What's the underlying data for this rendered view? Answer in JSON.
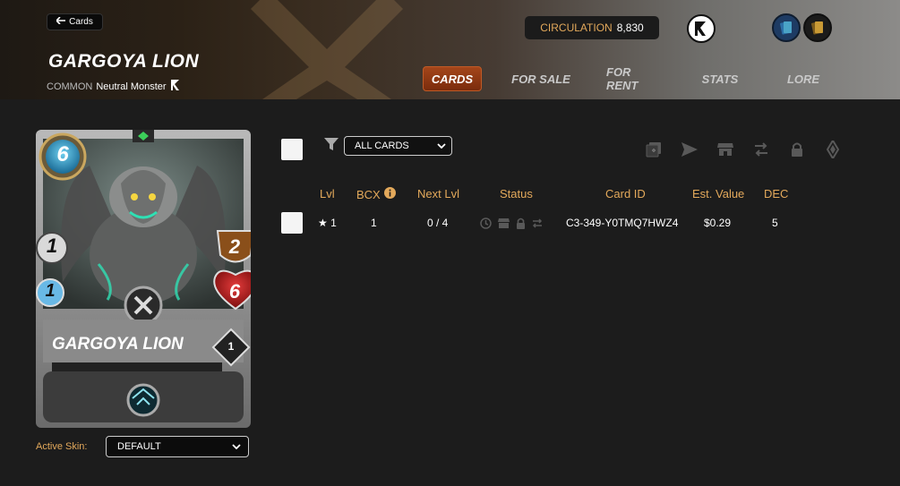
{
  "header": {
    "back_label": "Cards",
    "card_name": "GARGOYA LION",
    "rarity": "COMMON",
    "type": "Neutral Monster",
    "circulation_label": "CIRCULATION",
    "circulation_value": "8,830"
  },
  "tabs": [
    {
      "label": "CARDS",
      "active": true
    },
    {
      "label": "FOR SALE",
      "active": false
    },
    {
      "label": "FOR RENT",
      "active": false
    },
    {
      "label": "STATS",
      "active": false
    },
    {
      "label": "LORE",
      "active": false
    }
  ],
  "card": {
    "mana": "6",
    "melee": "1",
    "speed": "1",
    "armor": "2",
    "health": "6",
    "name": "GARGOYA LION",
    "level": "1"
  },
  "skin": {
    "label": "Active Skin:",
    "value": "DEFAULT"
  },
  "toolbar": {
    "filter_value": "ALL CARDS"
  },
  "table": {
    "headers": [
      "Lvl",
      "BCX",
      "Next Lvl",
      "Status",
      "Card ID",
      "Est. Value",
      "DEC"
    ],
    "rows": [
      {
        "lvl": "★ 1",
        "bcx": "1",
        "next_lvl": "0 / 4",
        "card_id": "C3-349-Y0TMQ7HWZ4",
        "est_value": "$0.29",
        "dec": "5"
      }
    ]
  },
  "colors": {
    "accent": "#e3a95b",
    "tab_active": "#a4461a",
    "background": "#1c1c1c"
  },
  "icons": [
    "arrow-left-icon",
    "monster-icon",
    "splinterlands-logo-icon",
    "blue-cards-icon",
    "gold-cards-icon",
    "filter-icon",
    "chevron-down-icon",
    "info-icon",
    "combine-icon",
    "send-icon",
    "market-icon",
    "transfer-icon",
    "lock-icon",
    "burn-icon",
    "clock-icon"
  ]
}
